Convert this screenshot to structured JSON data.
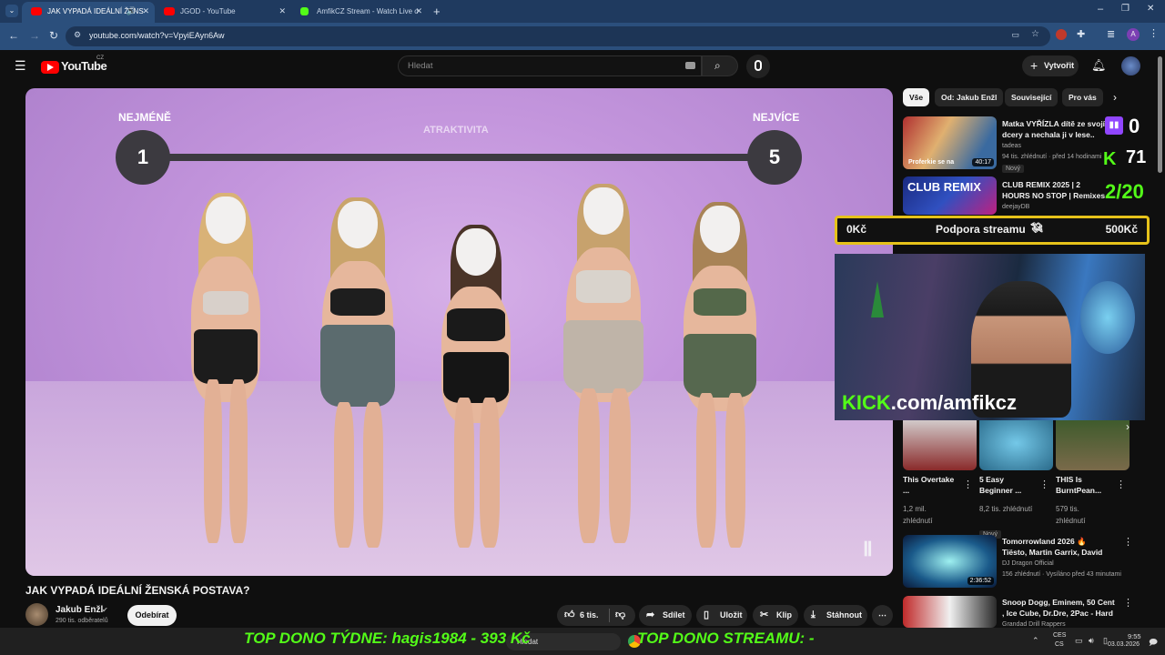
{
  "browser": {
    "tabs": [
      {
        "label": "JAK VYPADÁ IDEÁLNÍ ŽENS",
        "active": true
      },
      {
        "label": "JGOD - YouTube",
        "active": false
      },
      {
        "label": "AmfikCZ Stream - Watch Live o",
        "active": false
      }
    ],
    "url": "youtube.com/watch?v=VpyiEAyn6Aw"
  },
  "youtube": {
    "logo": "YouTube",
    "region": "CZ",
    "search_placeholder": "Hledat",
    "create_label": "Vytvořit"
  },
  "video": {
    "scale_left_label": "NEJMÉNĚ",
    "scale_right_label": "NEJVÍCE",
    "scale_center_label": "ATRAKTIVITA",
    "scale_min": "1",
    "scale_max": "5",
    "title": "JAK VYPADÁ IDEÁLNÍ ŽENSKÁ POSTAVA?",
    "channel": "Jakub Enžl",
    "subscribers": "290 tis. odběratelů",
    "unsubscribe_label": "Odebírat",
    "likes": "6 tis.",
    "share_label": "Sdílet",
    "save_label": "Uložit",
    "clip_label": "Klip",
    "download_label": "Stáhnout"
  },
  "chips": [
    "Vše",
    "Od: Jakub Enžl",
    "Související",
    "Pro vás"
  ],
  "recommendations": [
    {
      "title": "Matka VYŘÍZLA dítě ze svojí dcery a nechala ji v lese.. (za",
      "channel": "tadeas",
      "meta": "94 tis. zhlédnutí · před 14 hodinami",
      "duration": "40:17",
      "badge": "Nový",
      "thumb_text": "Proferkie se na"
    },
    {
      "title": "CLUB REMIX 2025 | 2 HOURS NO STOP | Remixes & Mashups",
      "channel": "deejayDB",
      "meta": "",
      "duration": "",
      "badge": "",
      "thumb_text": "CLUB REMIX"
    },
    {
      "title": "Tomorrowland 2026 🔥 Tiësto, Martin Garrix, David Guetta, ...",
      "channel": "DJ Dragon Official",
      "meta": "156 zhlédnutí · Vysíláno před 43 minutami",
      "duration": "2:36:52",
      "badge": ""
    },
    {
      "title": "Snoop Dogg, Eminem, 50 Cent , Ice Cube, Dr.Dre, 2Pac - Hard t...",
      "channel": "Grandad Drill Rappers",
      "meta": "",
      "duration": "",
      "badge": ""
    }
  ],
  "shorts": [
    {
      "title": "This Overtake ...",
      "views": "1,2 mil. zhlédnutí"
    },
    {
      "title": "5 Easy Beginner ...",
      "views": "8,2 tis. zhlédnutí"
    },
    {
      "title": "THIS Is BurntPean...",
      "views": "579 tis. zhlédnutí"
    }
  ],
  "overlay": {
    "twitch_count": "0",
    "kick_count": "71",
    "progress": "2/20",
    "donation_left": "0Kč",
    "donation_title": "Podpora streamu",
    "donation_right": "500Kč",
    "kick_url_brand": "KICK",
    "kick_url_rest": ".com/amfikcz",
    "top_dono": "TOP DONO TÝDNE:  hagis1984 - 393 Kč",
    "top_stream": "TOP DONO STREAMU: -",
    "badge_new": "Nový"
  },
  "taskbar": {
    "search_placeholder": "Hledat",
    "lang_top": "CES",
    "lang_bottom": "CS",
    "time": "9:55",
    "date": "03.03.2026"
  },
  "colors": {
    "kick_green": "#53fc18",
    "twitch_purple": "#9146ff",
    "youtube_red": "#ff0000",
    "donation_border": "#e6c21a"
  }
}
